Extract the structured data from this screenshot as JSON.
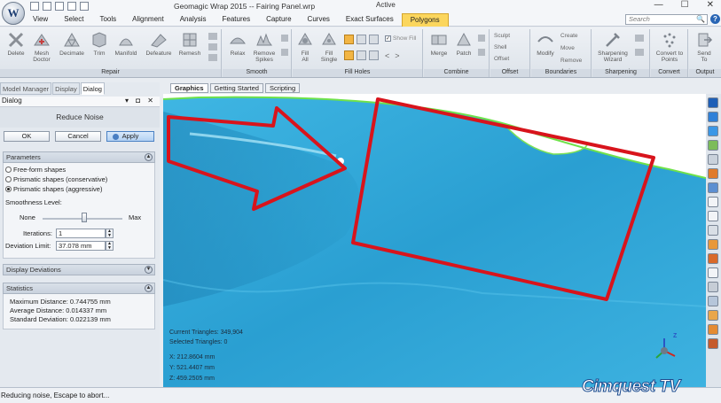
{
  "window": {
    "title": "Geomagic Wrap 2015 -- Fairing Panel.wrp",
    "active_label": "Active",
    "logo_letter": "W",
    "controls": [
      "—",
      "☐",
      "✕"
    ]
  },
  "menu": {
    "tabs": [
      "View",
      "Select",
      "Tools",
      "Alignment",
      "Analysis",
      "Features",
      "Capture",
      "Curves",
      "Exact Surfaces",
      "Polygons"
    ],
    "active_tab": "Polygons",
    "search_placeholder": "Search",
    "help_label": "?"
  },
  "ribbon": {
    "groups": {
      "repair": "Repair",
      "smooth": "Smooth",
      "fill_holes": "Fill Holes",
      "combine": "Combine",
      "offset": "Offset",
      "boundaries": "Boundaries",
      "sharpening": "Sharpening",
      "convert": "Convert",
      "output": "Output"
    },
    "buttons": {
      "delete": "Delete",
      "mesh_doctor_1": "Mesh",
      "mesh_doctor_2": "Doctor",
      "decimate": "Decimate",
      "trim": "Trim",
      "manifold": "Manifold",
      "defeature": "Defeature",
      "remesh": "Remesh",
      "relax": "Relax",
      "remove_spikes_1": "Remove",
      "remove_spikes_2": "Spikes",
      "fill_all_1": "Fill",
      "fill_all_2": "All",
      "fill_single_1": "Fill",
      "fill_single_2": "Single",
      "show_fill": "Show Fill",
      "merge": "Merge",
      "patch": "Patch",
      "sculpt": "Sculpt",
      "shell": "Shell",
      "offset": "Offset",
      "modify": "Modify",
      "create": "Create",
      "move": "Move",
      "remove": "Remove",
      "sharpening_wizard_1": "Sharpening",
      "sharpening_wizard_2": "Wizard",
      "convert_to_points_1": "Convert to",
      "convert_to_points_2": "Points",
      "send_to_1": "Send",
      "send_to_2": "To"
    }
  },
  "left_panel": {
    "tabs": [
      "Model Manager",
      "Display",
      "Dialog"
    ],
    "active_tab": "Dialog",
    "dialog_header": "Dialog",
    "dialog_controls": "▾ ◘ ✕",
    "dialog_title": "Reduce Noise",
    "ok_label": "OK",
    "cancel_label": "Cancel",
    "apply_label": "Apply",
    "parameters": {
      "header": "Parameters",
      "options": [
        "Free-form shapes",
        "Prismatic shapes (conservative)",
        "Prismatic shapes (aggressive)"
      ],
      "selected_index": 2,
      "smoothness_label": "Smoothness Level:",
      "smoothness_min": "None",
      "smoothness_max": "Max",
      "smoothness_level": 0.52,
      "iterations_label": "Iterations:",
      "iterations_value": "1",
      "deviation_label": "Deviation Limit:",
      "deviation_value": "37.078 mm"
    },
    "display_deviations": {
      "header": "Display Deviations"
    },
    "statistics": {
      "header": "Statistics",
      "max_distance": "Maximum Distance: 0.744755 mm",
      "avg_distance": "Average Distance: 0.014337 mm",
      "std_deviation": "Standard Deviation: 0.022139 mm"
    }
  },
  "viewport": {
    "tabs": [
      "Graphics",
      "Getting Started",
      "Scripting"
    ],
    "active_tab": "Graphics",
    "current_triangles": "Current Triangles: 349,904",
    "selected_triangles": "Selected Triangles: 0",
    "x_coord": "X:   212.8604 mm",
    "y_coord": "Y:   521.4407 mm",
    "z_coord": "Z:   459.2505 mm",
    "triad_label": "Z",
    "mesh_color": "#2fa8d8",
    "annotation_color": "#d8141c",
    "watermark": "Cimquest TV"
  },
  "status": {
    "text": "Reducing noise, Escape to abort..."
  }
}
